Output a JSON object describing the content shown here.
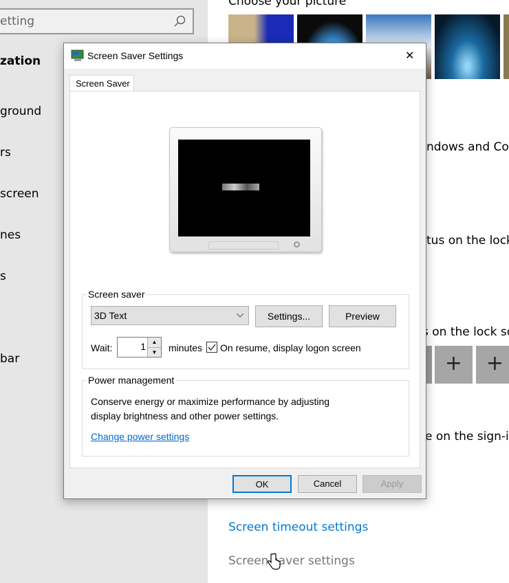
{
  "settings": {
    "search_text": "etting",
    "section_title": "zation",
    "nav": [
      "ground",
      "rs",
      "screen",
      "nes",
      "s",
      "bar"
    ],
    "choose_picture": "Choose your picture",
    "right_fragments": [
      "ndows and Cort",
      "tus on the lock s",
      "s on the lock scr",
      "e on the sign-in s"
    ],
    "plus": "+",
    "links": {
      "timeout": "Screen timeout settings",
      "saver": "Screen saver settings"
    },
    "accent": "#0078d7"
  },
  "dialog": {
    "title": "Screen Saver Settings",
    "close": "✕",
    "tab": "Screen Saver",
    "screen_saver_group": "Screen saver",
    "selected": "3D Text",
    "settings_btn": "Settings...",
    "preview_btn": "Preview",
    "wait_label": "Wait:",
    "wait_value": "1",
    "minutes": "minutes",
    "resume_checked": true,
    "resume_label": "On resume, display logon screen",
    "power_group": "Power management",
    "power_text1": "Conserve energy or maximize performance by adjusting",
    "power_text2": "display brightness and other power settings.",
    "power_link": "Change power settings",
    "ok": "OK",
    "cancel": "Cancel",
    "apply": "Apply"
  }
}
